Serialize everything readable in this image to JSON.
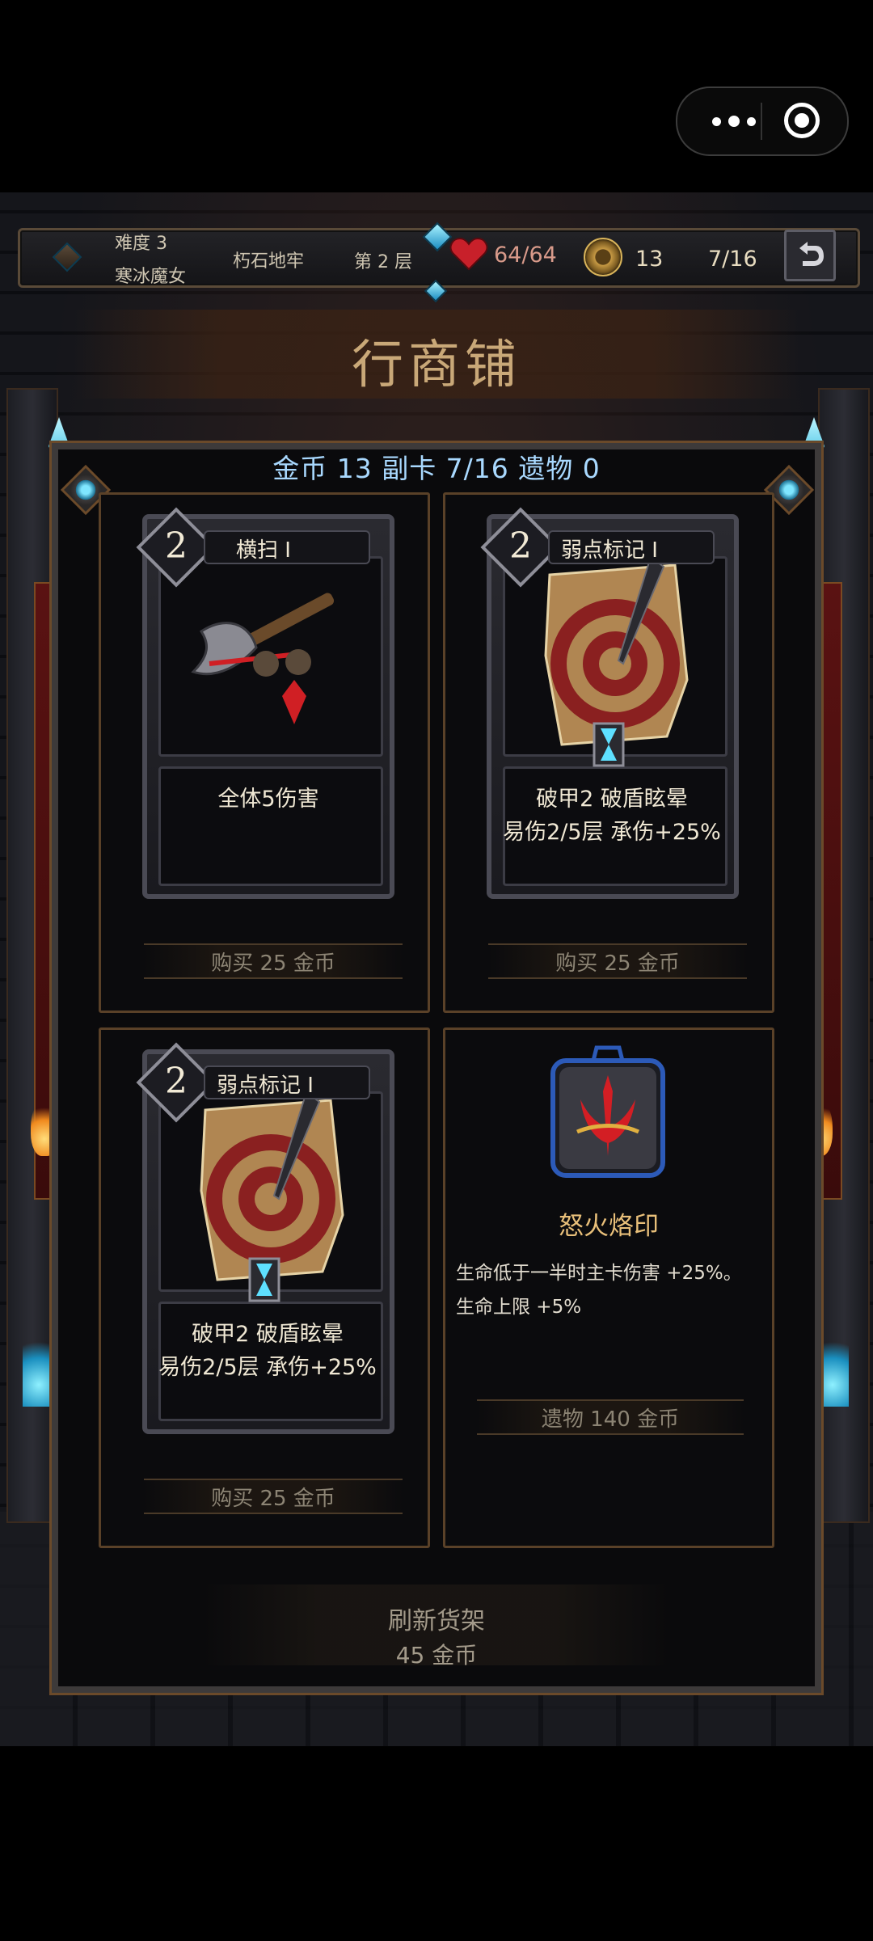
{
  "hud": {
    "difficulty": "难度 3",
    "character": "寒冰魔女",
    "location": "朽石地牢",
    "floor": "第 2 层",
    "hp": "64/64",
    "gold": "13",
    "cards": "7/16"
  },
  "title": "行商铺",
  "summary": "金币 13  副卡 7/16  遗物 0",
  "items": [
    {
      "cost": "2",
      "name": "横扫 I",
      "desc1": "全体5伤害",
      "desc2": "",
      "buy": "购买 25 金币"
    },
    {
      "cost": "2",
      "name": "弱点标记 I",
      "desc1": "破甲2 破盾眩晕",
      "desc2": "易伤2/5层 承伤+25%",
      "buy": "购买 25 金币"
    },
    {
      "cost": "2",
      "name": "弱点标记 I",
      "desc1": "破甲2 破盾眩晕",
      "desc2": "易伤2/5层 承伤+25%",
      "buy": "购买 25 金币"
    }
  ],
  "relic": {
    "name": "怒火烙印",
    "desc1": "生命低于一半时主卡伤害 +25%。",
    "desc2": "生命上限 +5%",
    "buy": "遗物 140 金币"
  },
  "refresh": {
    "label": "刷新货架",
    "price": "45 金币"
  },
  "icons": [
    "more-dots-icon",
    "target-icon",
    "heart-icon",
    "coin-icon",
    "back-arrow-icon",
    "axe-icon",
    "dagger-target-icon",
    "hourglass-icon",
    "rage-brand-icon"
  ],
  "colors": {
    "title": "#c9a878",
    "summary": "#a9d9ff",
    "relic_name": "#e9c07a",
    "gem": "#6fe0ff"
  }
}
